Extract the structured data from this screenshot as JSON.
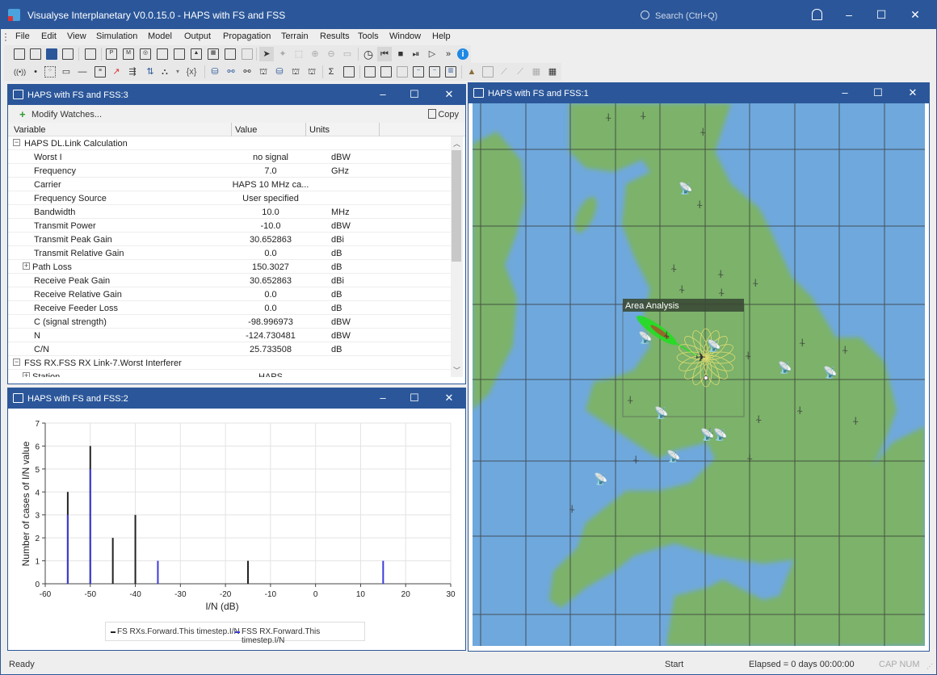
{
  "app": {
    "title": "Visualyse Interplanetary V0.0.15.0 - HAPS with FS and FSS",
    "search_placeholder": "Search (Ctrl+Q)",
    "window_controls": {
      "minimize": "–",
      "maximize": "☐",
      "close": "✕"
    }
  },
  "menu": [
    "File",
    "Edit",
    "View",
    "Simulation",
    "Model",
    "Output",
    "Propagation",
    "Terrain",
    "Results",
    "Tools",
    "Window",
    "Help"
  ],
  "toolbar": {
    "row1": [
      "new-icon",
      "open-icon",
      "save-icon",
      "close-file-icon",
      "copy-icon",
      "page-p-icon",
      "page-m-icon",
      "page-globe-icon",
      "page-network-icon",
      "page-glasses-icon",
      "page-terrain-icon",
      "page-table-icon",
      "page-wave-icon",
      "page-disabled-icon",
      "select-arrow-icon",
      "select-station-icon",
      "select-area-icon",
      "zoom-in-icon",
      "zoom-out-icon",
      "comment-icon",
      "clock-icon",
      "reset-icon",
      "stop-icon",
      "step-icon",
      "play-icon",
      "fast-forward-icon",
      "info-icon"
    ],
    "row2": [
      "antenna-icon",
      "dot-icon",
      "grid-points-icon",
      "rectangle-icon",
      "line-icon",
      "list-icon",
      "beam-icon",
      "link-icon",
      "arrows-icon",
      "station-group-icon",
      "variable-icon",
      "add-station-icon",
      "station-link-icon",
      "station-link2-icon",
      "station-group2-icon",
      "station-user-icon",
      "station-in-icon",
      "station-out-icon",
      "sum-icon",
      "export-icon",
      "watch-window-icon",
      "map-view-icon",
      "map-view2-icon",
      "plot-icon",
      "plot2-icon",
      "histogram-icon",
      "terrain-icon",
      "area-add-icon",
      "path-icon",
      "path-select-icon",
      "building-add-icon",
      "building-filter-icon"
    ],
    "variable_label": "{x}",
    "sum_label": "Σ"
  },
  "watch_window": {
    "title": "HAPS with FS and FSS:3",
    "modify_label": "Modify Watches...",
    "copy_label": "Copy",
    "columns": [
      "Variable",
      "Value",
      "Units"
    ],
    "rows": [
      {
        "type": "group",
        "toggle": "−",
        "variable": "HAPS DL.Link Calculation",
        "value": "",
        "units": ""
      },
      {
        "type": "item",
        "variable": "Worst I",
        "value": "no signal",
        "units": "dBW"
      },
      {
        "type": "item",
        "variable": "Frequency",
        "value": "7.0",
        "units": "GHz"
      },
      {
        "type": "item",
        "variable": "Carrier",
        "value": "HAPS 10 MHz ca...",
        "units": ""
      },
      {
        "type": "item",
        "variable": "Frequency Source",
        "value": "User specified",
        "units": ""
      },
      {
        "type": "item",
        "variable": "Bandwidth",
        "value": "10.0",
        "units": "MHz"
      },
      {
        "type": "item",
        "variable": "Transmit Power",
        "value": "-10.0",
        "units": "dBW"
      },
      {
        "type": "item",
        "variable": "Transmit Peak Gain",
        "value": "30.652863",
        "units": "dBi"
      },
      {
        "type": "item",
        "variable": "Transmit Relative Gain",
        "value": "0.0",
        "units": "dB"
      },
      {
        "type": "sub",
        "toggle": "+",
        "variable": "Path Loss",
        "value": "150.3027",
        "units": "dB"
      },
      {
        "type": "item",
        "variable": "Receive Peak Gain",
        "value": "30.652863",
        "units": "dBi"
      },
      {
        "type": "item",
        "variable": "Receive Relative Gain",
        "value": "0.0",
        "units": "dB"
      },
      {
        "type": "item",
        "variable": "Receive Feeder Loss",
        "value": "0.0",
        "units": "dB"
      },
      {
        "type": "item",
        "variable": "C (signal strength)",
        "value": "-98.996973",
        "units": "dBW"
      },
      {
        "type": "item",
        "variable": "N",
        "value": "-124.730481",
        "units": "dBW"
      },
      {
        "type": "item",
        "variable": "C/N",
        "value": "25.733508",
        "units": "dB"
      },
      {
        "type": "group",
        "toggle": "−",
        "variable": "FSS RX.FSS RX Link-7.Worst Interferer",
        "value": "",
        "units": ""
      },
      {
        "type": "sub",
        "toggle": "+",
        "variable": "Station",
        "value": "HAPS",
        "units": ""
      }
    ]
  },
  "chart_window": {
    "title": "HAPS with FS and FSS:2"
  },
  "chart_data": {
    "type": "bar",
    "title": "",
    "xlabel": "I/N (dB)",
    "ylabel": "Number of cases of I/N value",
    "xlim": [
      -60,
      30
    ],
    "ylim": [
      0,
      7
    ],
    "xticks": [
      -60,
      -50,
      -40,
      -30,
      -20,
      -10,
      0,
      10,
      20,
      30
    ],
    "yticks": [
      0,
      1,
      2,
      3,
      4,
      5,
      6,
      7
    ],
    "grid": true,
    "legend_position": "bottom",
    "series": [
      {
        "name": "FS RXs.Forward.This timestep.I/N",
        "color": "#222222",
        "x": [
          -55,
          -50,
          -45,
          -40,
          -15
        ],
        "values": [
          4,
          6,
          2,
          3,
          1
        ]
      },
      {
        "name": "FSS RX.Forward.This timestep.I/N",
        "color": "#3b3bdc",
        "x": [
          -55,
          -50,
          -35,
          15
        ],
        "values": [
          3,
          5,
          1,
          1
        ]
      }
    ]
  },
  "map_window": {
    "title": "HAPS with FS and FSS:1",
    "area_label": "Area Analysis",
    "colors": {
      "sea": "#6fa8dc",
      "land": "#7bb26a",
      "grid": "#333333",
      "beam": "#22dd22",
      "pattern": "#e8e070"
    }
  },
  "status": {
    "ready": "Ready",
    "start": "Start",
    "elapsed": "Elapsed = 0 days 00:00:00",
    "indicators": "CAP NUM"
  }
}
